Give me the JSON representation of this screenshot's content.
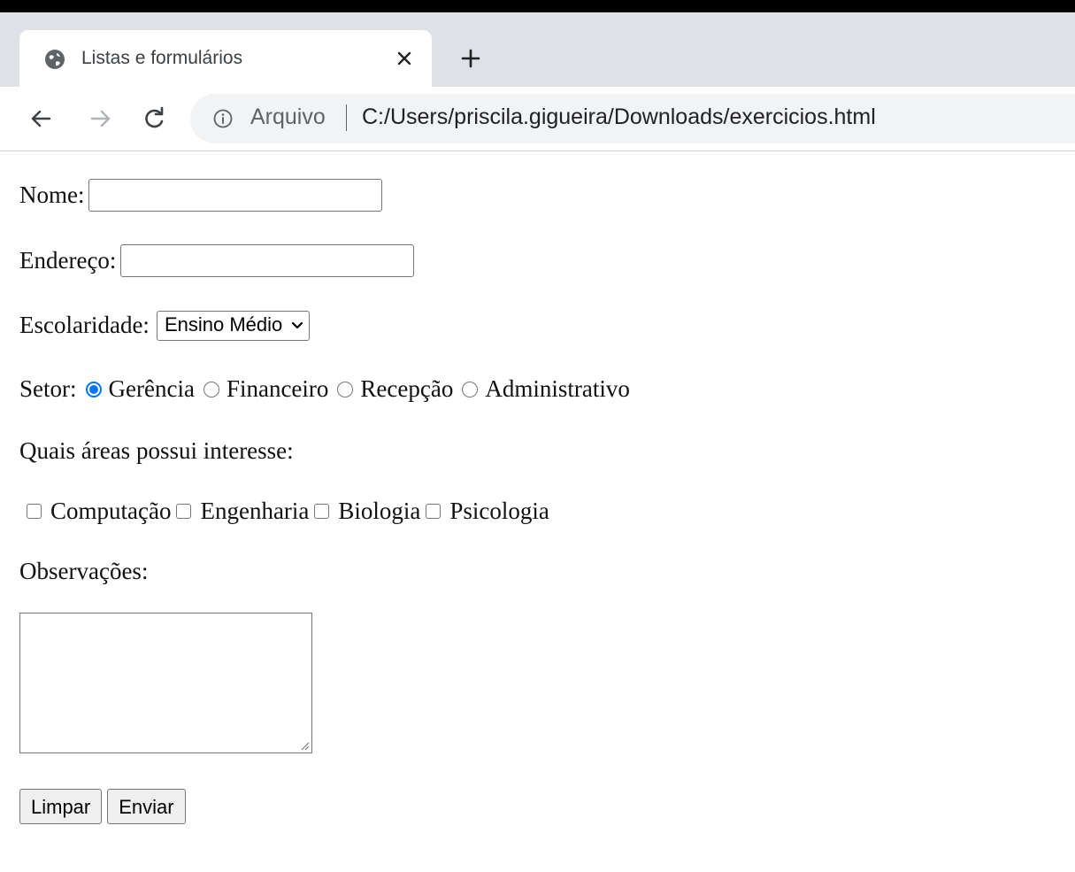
{
  "browser": {
    "tab_title": "Listas e formulários",
    "url_scheme": "Arquivo",
    "url_path": "C:/Users/priscila.gigueira/Downloads/exercicios.html",
    "icons": [
      "globe-icon",
      "close-icon",
      "plus-icon",
      "back-icon",
      "forward-icon",
      "reload-icon",
      "info-icon"
    ]
  },
  "form": {
    "nome_label": "Nome:",
    "nome_value": "",
    "endereco_label": "Endereço:",
    "endereco_value": "",
    "escolaridade_label": "Escolaridade:",
    "escolaridade_selected": "Ensino Médio",
    "setor_label": "Setor:",
    "setor_options": [
      {
        "label": "Gerência",
        "checked": true
      },
      {
        "label": "Financeiro",
        "checked": false
      },
      {
        "label": "Recepção",
        "checked": false
      },
      {
        "label": "Administrativo",
        "checked": false
      }
    ],
    "interesse_label": "Quais áreas possui interesse:",
    "interesse_options": [
      {
        "label": "Computação",
        "checked": false
      },
      {
        "label": "Engenharia",
        "checked": false
      },
      {
        "label": "Biologia",
        "checked": false
      },
      {
        "label": "Psicologia",
        "checked": false
      }
    ],
    "observacoes_label": "Observações:",
    "observacoes_value": "",
    "clear_button": "Limpar",
    "submit_button": "Enviar"
  },
  "colors": {
    "accent": "#0075ff",
    "tabstrip": "#dee1e6",
    "omnibox": "#f1f3f4"
  }
}
